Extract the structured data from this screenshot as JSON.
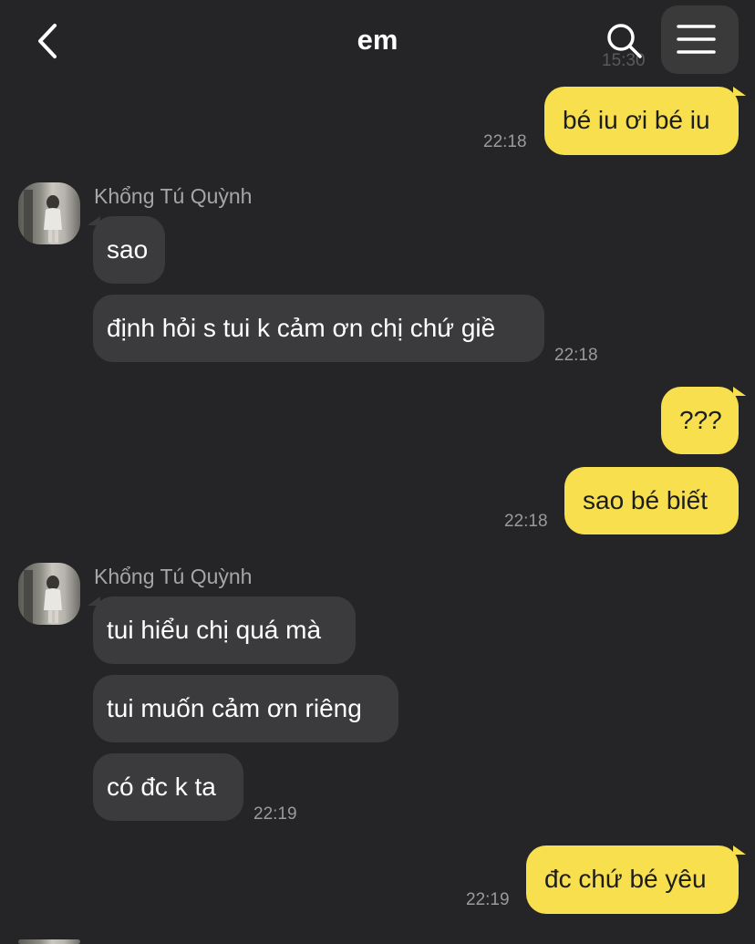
{
  "header": {
    "title": "em",
    "back_icon": "chevron-left-icon",
    "search_icon": "search-icon",
    "menu_icon": "hamburger-menu-icon",
    "ghost_time": "15:30"
  },
  "colors": {
    "background": "#252528",
    "my_bubble": "#f7df4e",
    "their_bubble": "#3b3b3e",
    "timestamp": "#9a9a9a"
  },
  "messages": {
    "m1": {
      "text": "bé iu ơi bé iu",
      "time": "22:18"
    },
    "g1": {
      "sender": "Khổng Tú Quỳnh",
      "m1": {
        "text": "sao"
      },
      "m2": {
        "text": "định hỏi s tui k cảm ơn chị chứ giề",
        "time": "22:18"
      }
    },
    "m2": {
      "text": "???"
    },
    "m3": {
      "text": "sao bé biết",
      "time": "22:18"
    },
    "g2": {
      "sender": "Khổng Tú Quỳnh",
      "m1": {
        "text": "tui hiểu chị quá mà"
      },
      "m2": {
        "text": "tui muốn cảm ơn riêng"
      },
      "m3": {
        "text": "có đc k ta",
        "time": "22:19"
      }
    },
    "m4": {
      "text": "đc chứ bé yêu",
      "time": "22:19"
    }
  }
}
